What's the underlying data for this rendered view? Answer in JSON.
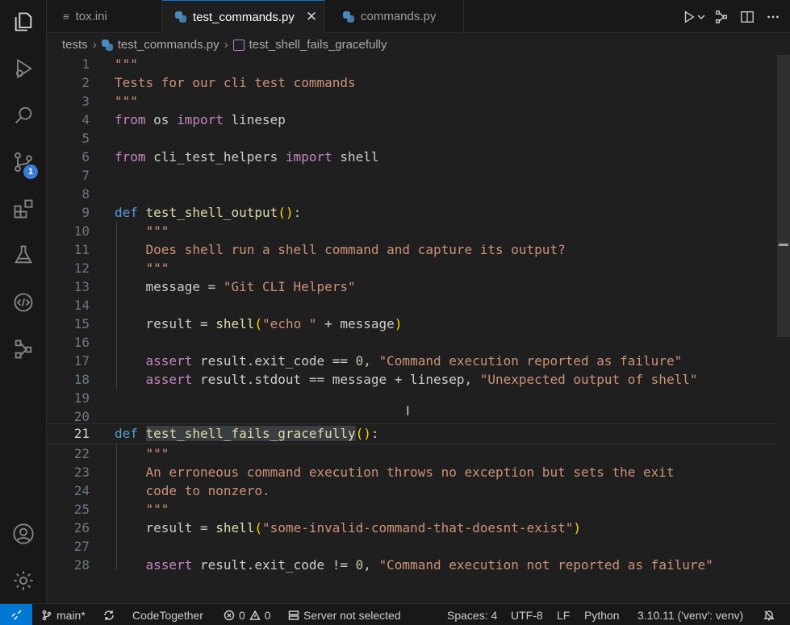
{
  "tabs": [
    {
      "label": "tox.ini",
      "icon": "list-icon"
    },
    {
      "label": "test_commands.py",
      "icon": "python-icon",
      "active": true
    },
    {
      "label": "commands.py",
      "icon": "python-icon"
    }
  ],
  "tab_close_glyph": "✕",
  "breadcrumb": {
    "folder": "tests",
    "file": "test_commands.py",
    "symbol": "test_shell_fails_gracefully"
  },
  "activity_bar": {
    "source_control_badge": "1"
  },
  "line_numbers": [
    "1",
    "2",
    "3",
    "4",
    "5",
    "6",
    "7",
    "8",
    "9",
    "10",
    "11",
    "12",
    "13",
    "14",
    "15",
    "16",
    "17",
    "18",
    "19",
    "20",
    "21",
    "22",
    "23",
    "24",
    "25",
    "26",
    "27",
    "28"
  ],
  "code": {
    "l1_docstring": "\"\"\"",
    "l2_docstring": "Tests for our cli test commands",
    "l3_docstring": "\"\"\"",
    "l4_from": "from",
    "l4_module": " os ",
    "l4_import": "import",
    "l4_name": " linesep",
    "l6_from": "from",
    "l6_module": " cli_test_helpers ",
    "l6_import": "import",
    "l6_name": " shell",
    "l9_def": "def",
    "l9_fn": "test_shell_output",
    "l10_doc": "\"\"\"",
    "l11_doc": "Does shell run a shell command and capture its output?",
    "l12_doc": "\"\"\"",
    "l13_lhs": "message = ",
    "l13_str": "\"Git CLI Helpers\"",
    "l15_lhs": "result = ",
    "l15_fn": "shell",
    "l15_str": "\"echo \"",
    "l15_rest": " + message",
    "l17_assert": "assert",
    "l17_mid": " result.exit_code == ",
    "l17_num": "0",
    "l17_comma": ", ",
    "l17_str": "\"Command execution reported as failure\"",
    "l18_assert": "assert",
    "l18_mid": " result.stdout == message + linesep, ",
    "l18_str": "\"Unexpected output of shell\"",
    "l21_def": "def",
    "l21_fn": "test_shell_fails_gracefully",
    "l22_doc": "\"\"\"",
    "l23_doc": "An erroneous command execution throws no exception but sets the exit",
    "l24_doc": "code to nonzero.",
    "l25_doc": "\"\"\"",
    "l26_lhs": "result = ",
    "l26_fn": "shell",
    "l26_str": "\"some-invalid-command-that-doesnt-exist\"",
    "l28_assert": "assert",
    "l28_mid": " result.exit_code != ",
    "l28_num": "0",
    "l28_comma": ", ",
    "l28_str": "\"Command execution not reported as failure\""
  },
  "status": {
    "branch": "main*",
    "codetogether": "CodeTogether",
    "errors": "0",
    "warnings": "0",
    "server": "Server not selected",
    "spaces": "Spaces: 4",
    "encoding": "UTF-8",
    "eol": "LF",
    "language": "Python",
    "interpreter": "3.10.11 ('venv': venv)"
  },
  "colors": {
    "accent": "#0078d4",
    "keyword": "#c586c0",
    "def": "#569cd6",
    "function": "#dcdcaa",
    "string": "#ce9178",
    "number": "#b5cea8"
  }
}
